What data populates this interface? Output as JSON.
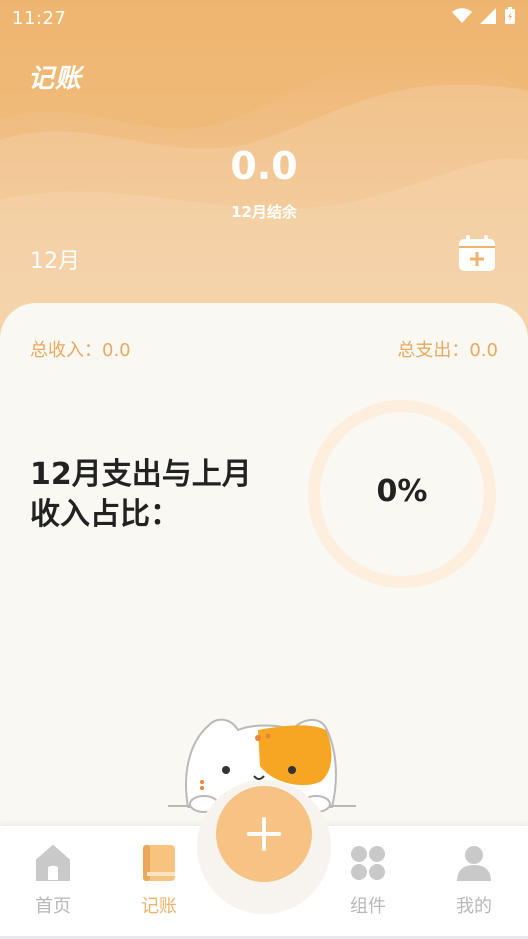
{
  "status": {
    "time": "11:27"
  },
  "header": {
    "title": "记账",
    "balance": "0.0",
    "balance_label": "12月结余",
    "month": "12月"
  },
  "summary": {
    "income": "总收入：0.0",
    "expense": "总支出：0.0",
    "ratio_label": "12月支出与上月收入占比：",
    "ratio_value": "0%"
  },
  "nav": {
    "items": [
      {
        "label": "首页",
        "icon": "home-icon"
      },
      {
        "label": "记账",
        "icon": "book-icon"
      },
      {
        "label": "组件",
        "icon": "widget-icon"
      },
      {
        "label": "我的",
        "icon": "person-icon"
      }
    ],
    "fab_icon": "plus-icon"
  },
  "colors": {
    "accent": "#f0b36b",
    "fab": "#f7c384",
    "ring": "#fdeedd"
  }
}
